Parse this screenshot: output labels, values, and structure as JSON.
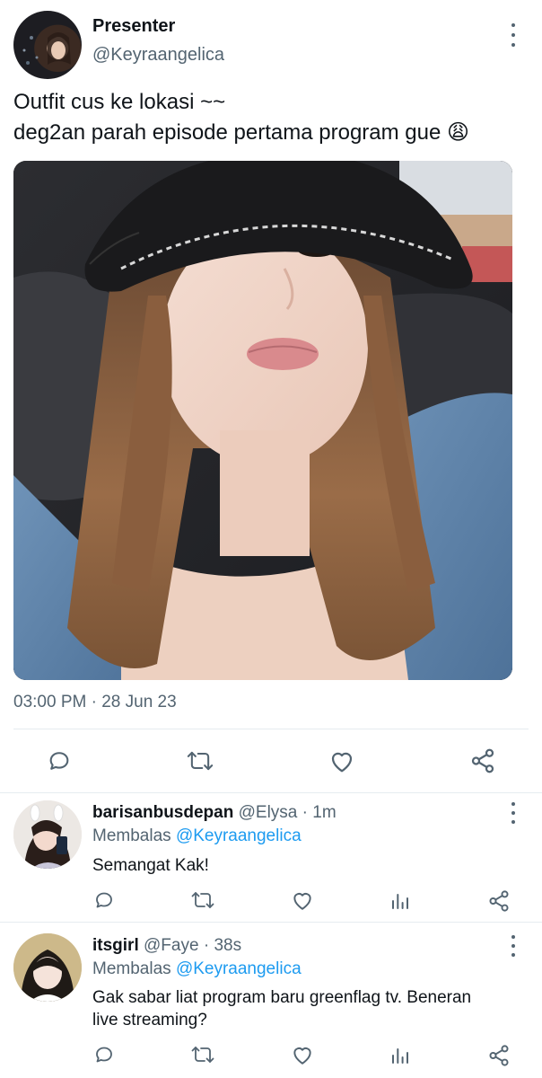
{
  "colors": {
    "accent": "#1d9bf0",
    "muted": "#536471",
    "text": "#0f1419"
  },
  "main_tweet": {
    "display_name": "Presenter",
    "handle": "@Keyraangelica",
    "text_line1": "Outfit cus ke lokasi ~~",
    "text_line2": "deg2an parah episode pertama program gue",
    "emoji": "😩",
    "time": "03:00 PM",
    "date_sep": "·",
    "date": "28 Jun 23",
    "actions": [
      "reply-icon",
      "retweet-icon",
      "like-icon",
      "share-icon"
    ]
  },
  "replies": [
    {
      "display_name": "barisanbusdepan",
      "handle": "@Elysa",
      "sep": "·",
      "age": "1m",
      "replying_prefix": "Membalas",
      "replying_to": "@Keyraangelica",
      "text": "Semangat Kak!",
      "actions": [
        "reply-icon",
        "retweet-icon",
        "like-icon",
        "analytics-icon",
        "share-icon"
      ]
    },
    {
      "display_name": "itsgirl",
      "handle": "@Faye",
      "sep": "·",
      "age": "38s",
      "replying_prefix": "Membalas",
      "replying_to": "@Keyraangelica",
      "text_line1": "Gak sabar liat program baru greenflag tv. Beneran",
      "text_line2": "live streaming?",
      "actions": [
        "reply-icon",
        "retweet-icon",
        "like-icon",
        "analytics-icon",
        "share-icon"
      ]
    }
  ]
}
